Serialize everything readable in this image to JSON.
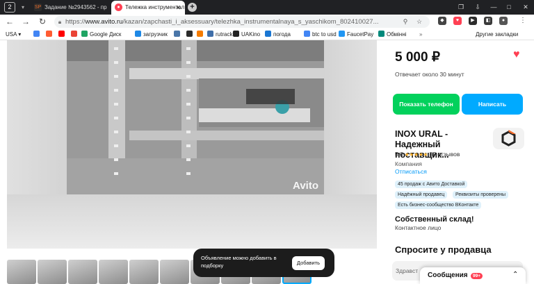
{
  "browser": {
    "tab_counter": "2",
    "tabs": [
      {
        "title": "Задание №2943562 - про",
        "favicon": "SP"
      },
      {
        "title": "Тележка инструментал",
        "favicon": "avito-icon"
      }
    ],
    "url_prefix": "https://",
    "url_host": "www.avito.ru",
    "url_path": "/kazan/zapchasti_i_aksessuary/telezhka_instrumentalnaya_s_yaschikom_802410027...",
    "bookmarks": [
      {
        "label": "USA",
        "color": "#555555"
      },
      {
        "label": "",
        "color": "#4285f4"
      },
      {
        "label": "",
        "color": "#ff5c32"
      },
      {
        "label": "",
        "color": "#ff0000"
      },
      {
        "label": "",
        "color": "#ea4335"
      },
      {
        "label": "Google Диск",
        "color": "#1fa463"
      },
      {
        "label": "загрузчик",
        "color": "#1e88e5"
      },
      {
        "label": "",
        "color": "#4a76a8"
      },
      {
        "label": "",
        "color": "#2b2b2b"
      },
      {
        "label": "",
        "color": "#f57c00"
      },
      {
        "label": "rutracker",
        "color": "#3f6ea8"
      },
      {
        "label": "UAKino",
        "color": "#222222"
      },
      {
        "label": "погода",
        "color": "#1976d2"
      },
      {
        "label": "btc to usd",
        "color": "#4285f4"
      },
      {
        "label": "FaucetPay",
        "color": "#2196f3"
      },
      {
        "label": "Обмінні",
        "color": "#00897b"
      }
    ],
    "other_bookmarks": "Другие закладки"
  },
  "gallery": {
    "watermark": "Avito",
    "thumbnail_count": 10
  },
  "toast": {
    "text": "Объявление можно добавить в подборку",
    "button": "Добавить"
  },
  "listing": {
    "price": "5 000 ₽",
    "reply_time": "Отвечает около 30 минут",
    "show_phone": "Показать телефон",
    "write": "Написать"
  },
  "seller": {
    "name": "INOX URAL - Надежный поставщик...",
    "rating": "5.0",
    "stars": "★★★★★",
    "reviews": "87 отзывов",
    "type": "Компания",
    "since": "Отписаться",
    "badges": [
      "45 продаж с Авито Доставкой",
      "Надёжный продавец",
      "Реквизиты проверены",
      "Есть бизнес-сообщество ВКонтакте"
    ],
    "warehouse": "Собственный склад!",
    "contact_person": "Контактное лицо"
  },
  "ask_seller": {
    "title": "Спросите у продавца",
    "input_value": "Здравст"
  },
  "messages": {
    "label": "Сообщения",
    "count": "99+"
  }
}
